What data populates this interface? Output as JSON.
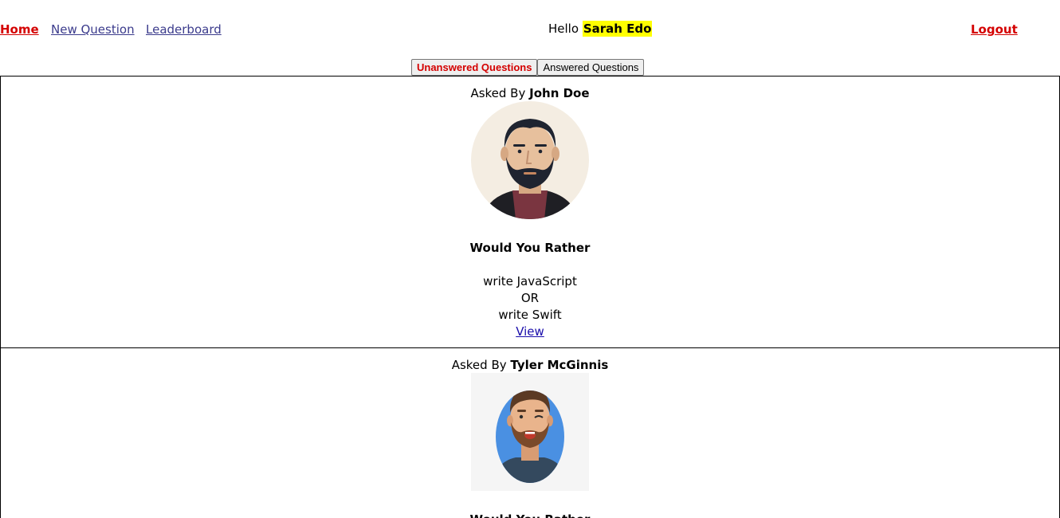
{
  "nav": {
    "home": "Home",
    "new_question": "New Question",
    "leaderboard": "Leaderboard",
    "logout": "Logout",
    "greeting": "Hello",
    "user_name": "Sarah Edo"
  },
  "tabs": {
    "unanswered": "Unanswered Questions",
    "answered": "Answered Questions",
    "active": "unanswered"
  },
  "questions": [
    {
      "asked_by_label": "Asked By",
      "author": "John Doe",
      "avatar_icon": "bearded-man-avatar",
      "heading": "Would You Rather",
      "option_one": "write JavaScript",
      "or_label": "OR",
      "option_two": "write Swift",
      "view_label": "View"
    },
    {
      "asked_by_label": "Asked By",
      "author": "Tyler McGinnis",
      "avatar_icon": "winking-man-avatar",
      "heading": "Would You Rather"
    }
  ],
  "colors": {
    "accent_red": "#d40000",
    "highlight": "#ffff00",
    "link": "#1a0dab"
  }
}
